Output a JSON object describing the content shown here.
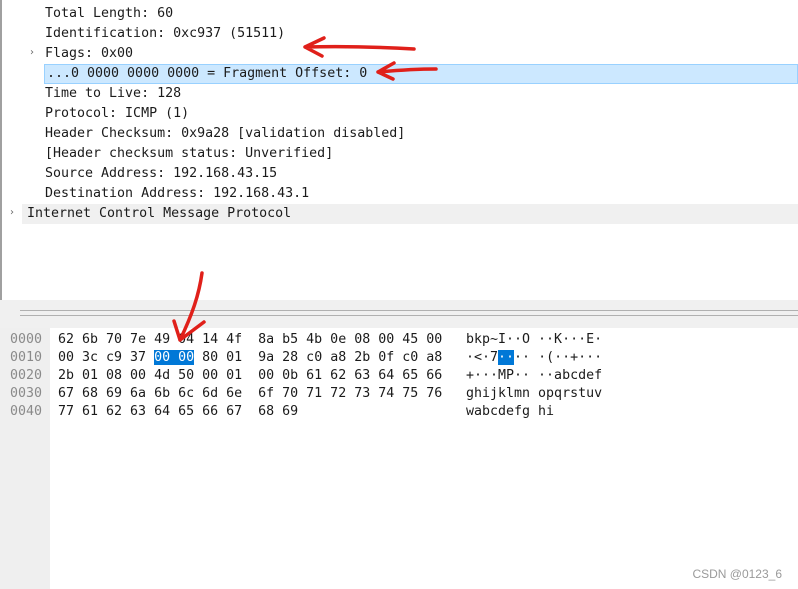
{
  "details": {
    "total_length": "Total Length: 60",
    "identification": "Identification: 0xc937 (51511)",
    "flags": "Flags: 0x00",
    "fragment_offset": "...0 0000 0000 0000 = Fragment Offset: 0",
    "ttl": "Time to Live: 128",
    "protocol": "Protocol: ICMP (1)",
    "checksum": "Header Checksum: 0x9a28 [validation disabled]",
    "checksum_status": "[Header checksum status: Unverified]",
    "source": "Source Address: 192.168.43.15",
    "destination": "Destination Address: 192.168.43.1",
    "icmp": "Internet Control Message Protocol",
    "chevron": "›"
  },
  "bytes": {
    "rows": [
      {
        "offset": "0000",
        "hex_pre": "62 6b 70 7e 49 04 14 4f  8a b5 4b 0e 08 00 45 00",
        "hex_sel": "",
        "hex_post": "",
        "ascii_pre": "bkp~I··O ··K···E·",
        "ascii_sel": "",
        "ascii_post": ""
      },
      {
        "offset": "0010",
        "hex_pre": "00 3c c9 37 ",
        "hex_sel": "00 00",
        "hex_post": " 80 01  9a 28 c0 a8 2b 0f c0 a8",
        "ascii_pre": "·<·7",
        "ascii_sel": "··",
        "ascii_post": "·· ·(··+···"
      },
      {
        "offset": "0020",
        "hex_pre": "2b 01 08 00 4d 50 00 01  00 0b 61 62 63 64 65 66",
        "hex_sel": "",
        "hex_post": "",
        "ascii_pre": "+···MP·· ··abcdef",
        "ascii_sel": "",
        "ascii_post": ""
      },
      {
        "offset": "0030",
        "hex_pre": "67 68 69 6a 6b 6c 6d 6e  6f 70 71 72 73 74 75 76",
        "hex_sel": "",
        "hex_post": "",
        "ascii_pre": "ghijklmn opqrstuv",
        "ascii_sel": "",
        "ascii_post": ""
      },
      {
        "offset": "0040",
        "hex_pre": "77 61 62 63 64 65 66 67  68 69",
        "hex_sel": "",
        "hex_post": "",
        "ascii_pre": "wabcdefg hi",
        "ascii_sel": "",
        "ascii_post": ""
      }
    ]
  },
  "watermark": "CSDN @0123_6",
  "colors": {
    "selection_row": "#cce8ff",
    "hex_selection": "#0078d7",
    "annotation": "#e0201a"
  }
}
